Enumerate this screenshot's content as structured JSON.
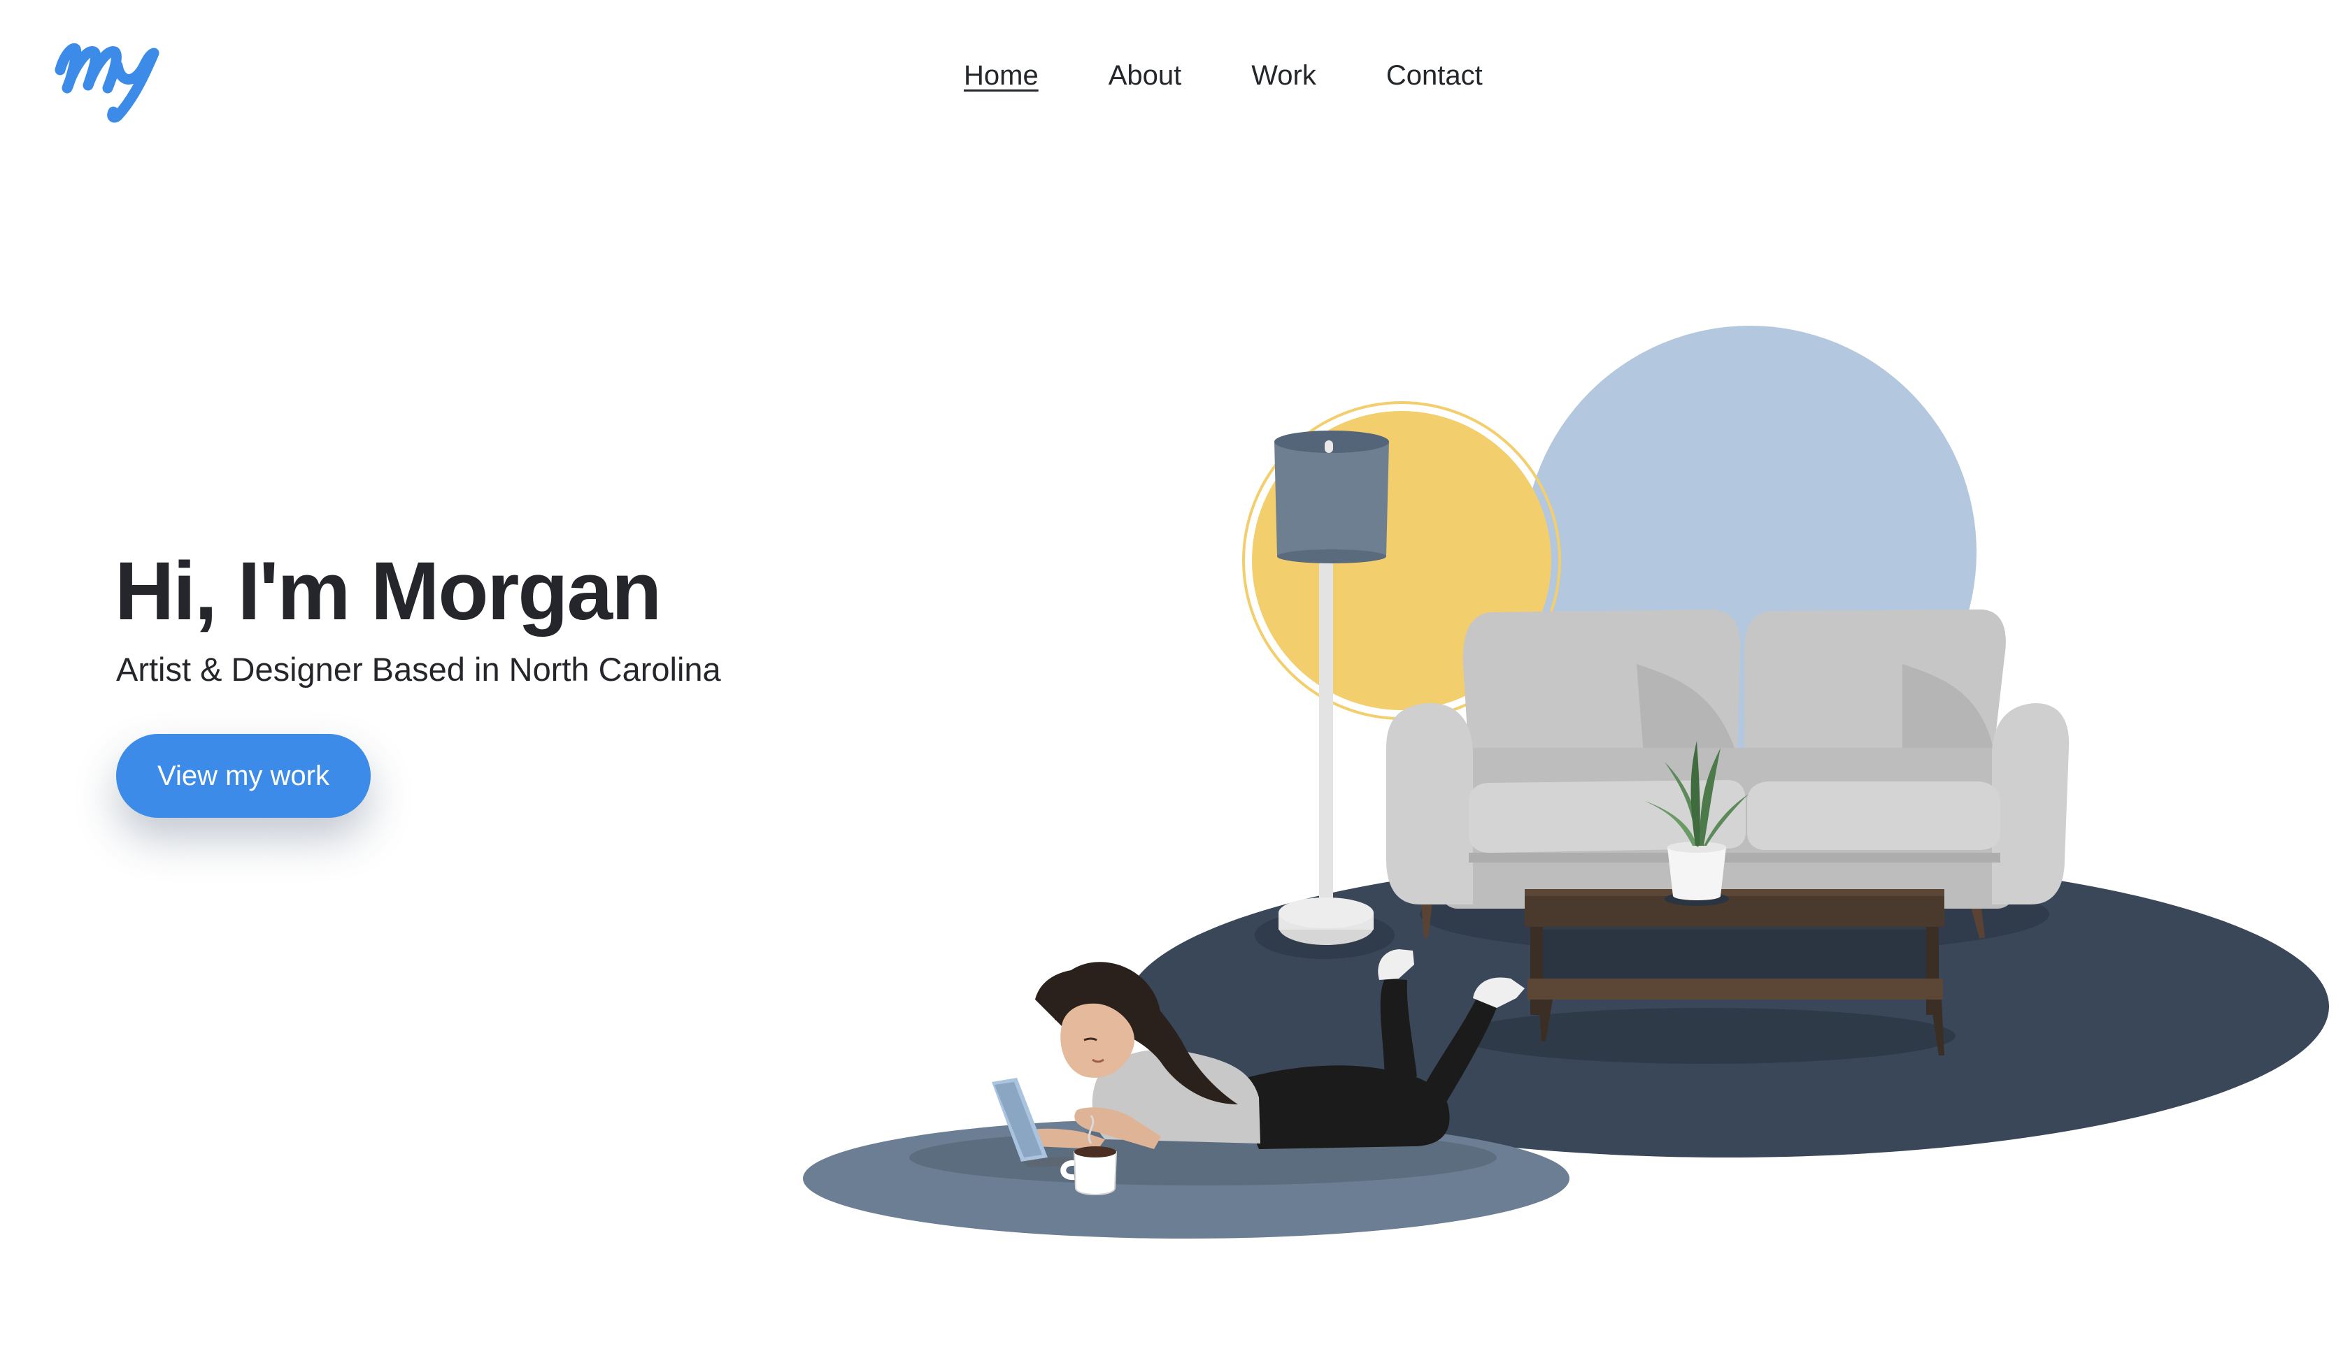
{
  "nav": {
    "items": [
      {
        "label": "Home",
        "active": true
      },
      {
        "label": "About",
        "active": false
      },
      {
        "label": "Work",
        "active": false
      },
      {
        "label": "Contact",
        "active": false
      }
    ]
  },
  "logo": {
    "icon": "my-script-logo",
    "color": "#3d8be8"
  },
  "hero": {
    "title": "Hi, I'm Morgan",
    "subtitle": "Artist & Designer Based in North Carolina",
    "cta_label": "View my work"
  },
  "colors": {
    "accent": "#3d8be8",
    "text": "#24262b",
    "rug_dark": "#394759",
    "rug_light": "#6c7e93",
    "circle_blue": "#b3c8de",
    "circle_yellow": "#f3ce6d"
  }
}
